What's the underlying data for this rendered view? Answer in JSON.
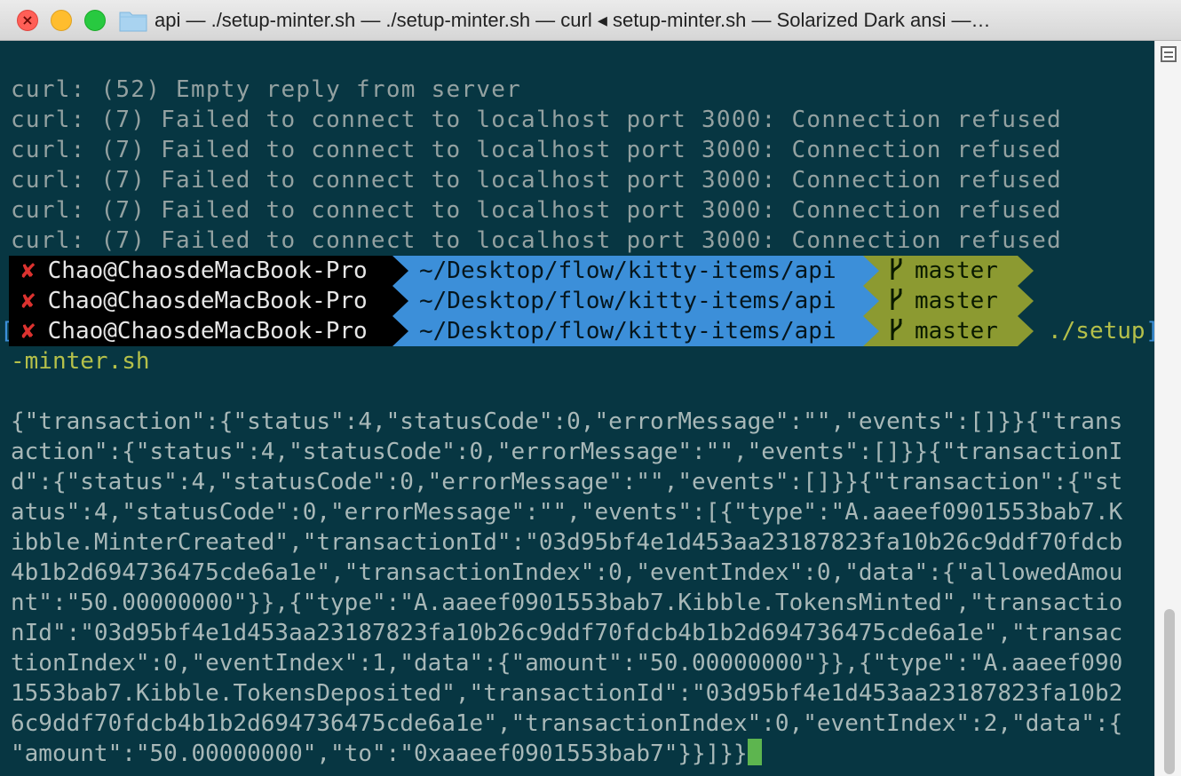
{
  "window": {
    "title": "api — ./setup-minter.sh — ./setup-minter.sh — curl ◂ setup-minter.sh — Solarized Dark ansi —…",
    "colors": {
      "background": "#073642",
      "text": "#93a1a1",
      "path_segment": "#3c8fd9",
      "git_segment": "#8c9a31",
      "error_cross": "#dc322f",
      "cursor": "#5db54f"
    }
  },
  "icons": [
    "close-icon",
    "folder-icon",
    "branch-icon",
    "split-pane-icon"
  ],
  "terminal": {
    "curl_lines": [
      "curl: (52) Empty reply from server",
      "curl: (7) Failed to connect to localhost port 3000: Connection refused",
      "curl: (7) Failed to connect to localhost port 3000: Connection refused",
      "curl: (7) Failed to connect to localhost port 3000: Connection refused",
      "curl: (7) Failed to connect to localhost port 3000: Connection refused",
      "curl: (7) Failed to connect to localhost port 3000: Connection refused"
    ],
    "prompts": [
      {
        "status": "✘",
        "user": "Chao@ChaosdeMacBook-Pro",
        "path": "~/Desktop/flow/kitty-items/api",
        "branch": "master",
        "command": ""
      },
      {
        "status": "✘",
        "user": "Chao@ChaosdeMacBook-Pro",
        "path": "~/Desktop/flow/kitty-items/api",
        "branch": "master",
        "command": ""
      },
      {
        "status": "✘",
        "user": "Chao@ChaosdeMacBook-Pro",
        "path": "~/Desktop/flow/kitty-items/api",
        "branch": "master",
        "command": "./setup"
      }
    ],
    "bracket_left": "[",
    "bracket_right": "]",
    "command_continuation": "-minter.sh",
    "json_lines": [
      "{\"transaction\":{\"status\":4,\"statusCode\":0,\"errorMessage\":\"\",\"events\":[]}}{\"trans",
      "action\":{\"status\":4,\"statusCode\":0,\"errorMessage\":\"\",\"events\":[]}}{\"transactionI",
      "d\":{\"status\":4,\"statusCode\":0,\"errorMessage\":\"\",\"events\":[]}}{\"transaction\":{\"st",
      "atus\":4,\"statusCode\":0,\"errorMessage\":\"\",\"events\":[{\"type\":\"A.aaeef0901553bab7.K",
      "ibble.MinterCreated\",\"transactionId\":\"03d95bf4e1d453aa23187823fa10b26c9ddf70fdcb",
      "4b1b2d694736475cde6a1e\",\"transactionIndex\":0,\"eventIndex\":0,\"data\":{\"allowedAmou",
      "nt\":\"50.00000000\"}},{\"type\":\"A.aaeef0901553bab7.Kibble.TokensMinted\",\"transactio",
      "nId\":\"03d95bf4e1d453aa23187823fa10b26c9ddf70fdcb4b1b2d694736475cde6a1e\",\"transac",
      "tionIndex\":0,\"eventIndex\":1,\"data\":{\"amount\":\"50.00000000\"}},{\"type\":\"A.aaeef090",
      "1553bab7.Kibble.TokensDeposited\",\"transactionId\":\"03d95bf4e1d453aa23187823fa10b2",
      "6c9ddf70fdcb4b1b2d694736475cde6a1e\",\"transactionIndex\":0,\"eventIndex\":2,\"data\":{",
      "\"amount\":\"50.00000000\",\"to\":\"0xaaeef0901553bab7\"}}]}}"
    ]
  }
}
